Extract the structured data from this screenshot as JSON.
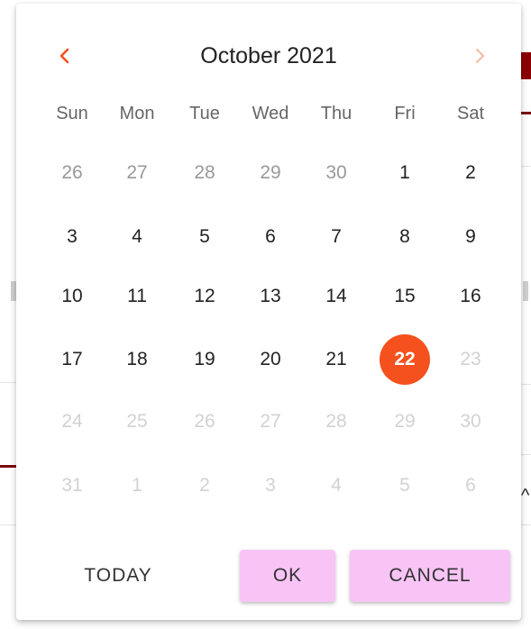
{
  "calendar": {
    "month_title": "October 2021",
    "prev_icon": "chevron-left-icon",
    "next_icon": "chevron-right-icon",
    "colors": {
      "accent": "#f4511e",
      "prev_arrow": "#f4511e",
      "next_arrow": "#f6b8a2",
      "button_bg": "#f8c4f6"
    },
    "weekdays": [
      "Sun",
      "Mon",
      "Tue",
      "Wed",
      "Thu",
      "Fri",
      "Sat"
    ],
    "weeks": [
      [
        {
          "label": "26",
          "state": "outside"
        },
        {
          "label": "27",
          "state": "outside"
        },
        {
          "label": "28",
          "state": "outside"
        },
        {
          "label": "29",
          "state": "outside"
        },
        {
          "label": "30",
          "state": "outside"
        },
        {
          "label": "1",
          "state": "normal"
        },
        {
          "label": "2",
          "state": "normal"
        }
      ],
      [
        {
          "label": "3",
          "state": "normal"
        },
        {
          "label": "4",
          "state": "normal"
        },
        {
          "label": "5",
          "state": "normal"
        },
        {
          "label": "6",
          "state": "normal"
        },
        {
          "label": "7",
          "state": "normal"
        },
        {
          "label": "8",
          "state": "normal"
        },
        {
          "label": "9",
          "state": "normal"
        }
      ],
      [
        {
          "label": "10",
          "state": "normal"
        },
        {
          "label": "11",
          "state": "normal"
        },
        {
          "label": "12",
          "state": "normal"
        },
        {
          "label": "13",
          "state": "normal"
        },
        {
          "label": "14",
          "state": "normal"
        },
        {
          "label": "15",
          "state": "normal"
        },
        {
          "label": "16",
          "state": "normal"
        }
      ],
      [
        {
          "label": "17",
          "state": "normal"
        },
        {
          "label": "18",
          "state": "normal"
        },
        {
          "label": "19",
          "state": "normal"
        },
        {
          "label": "20",
          "state": "normal"
        },
        {
          "label": "21",
          "state": "normal"
        },
        {
          "label": "22",
          "state": "selected"
        },
        {
          "label": "23",
          "state": "disabled"
        }
      ],
      [
        {
          "label": "24",
          "state": "disabled"
        },
        {
          "label": "25",
          "state": "disabled"
        },
        {
          "label": "26",
          "state": "disabled"
        },
        {
          "label": "27",
          "state": "disabled"
        },
        {
          "label": "28",
          "state": "disabled"
        },
        {
          "label": "29",
          "state": "disabled"
        },
        {
          "label": "30",
          "state": "disabled"
        }
      ],
      [
        {
          "label": "31",
          "state": "disabled"
        },
        {
          "label": "1",
          "state": "disabled"
        },
        {
          "label": "2",
          "state": "disabled"
        },
        {
          "label": "3",
          "state": "disabled"
        },
        {
          "label": "4",
          "state": "disabled"
        },
        {
          "label": "5",
          "state": "disabled"
        },
        {
          "label": "6",
          "state": "disabled"
        }
      ]
    ],
    "actions": {
      "today_label": "TODAY",
      "ok_label": "OK",
      "cancel_label": "CANCEL"
    }
  }
}
